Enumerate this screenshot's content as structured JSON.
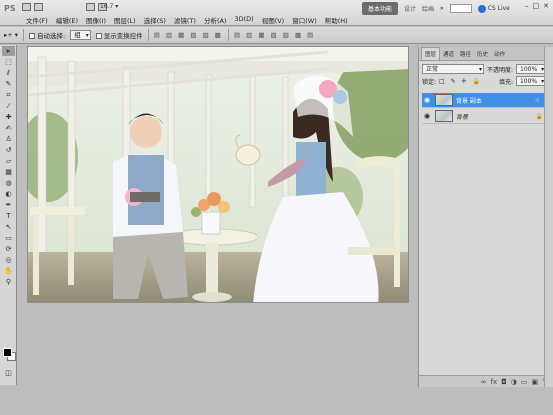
{
  "app": {
    "logo": "PS",
    "zoom": "16.7"
  },
  "menu": {
    "items": [
      "文件(F)",
      "编辑(E)",
      "图像(I)",
      "图层(L)",
      "选择(S)",
      "滤镜(T)",
      "分析(A)",
      "3D(D)",
      "视图(V)",
      "窗口(W)",
      "帮助(H)"
    ]
  },
  "topright": {
    "workspace_active": "基本功能",
    "workspace_links": [
      "设计",
      "绘画"
    ],
    "cslive": "CS Live"
  },
  "options": {
    "auto_select_label": "自动选择:",
    "auto_select_value": "组",
    "show_transform_label": "显示变换控件"
  },
  "layers_panel": {
    "tabs": [
      "图层",
      "通道",
      "路径",
      "历史",
      "动作"
    ],
    "blend_mode": "正常",
    "opacity_label": "不透明度:",
    "opacity_value": "100%",
    "lock_label": "锁定:",
    "fill_label": "填充:",
    "fill_value": "100%",
    "layers": [
      {
        "name": "背景 副本",
        "selected": true
      },
      {
        "name": "背景",
        "selected": false
      }
    ]
  },
  "tools": [
    "move",
    "marquee",
    "lasso",
    "quick-select",
    "crop",
    "eyedropper",
    "healing",
    "brush",
    "clone-stamp",
    "history-brush",
    "eraser",
    "gradient",
    "blur",
    "dodge",
    "pen",
    "type",
    "path-select",
    "shape",
    "3d-rotate",
    "3d-orbit",
    "hand",
    "zoom"
  ]
}
